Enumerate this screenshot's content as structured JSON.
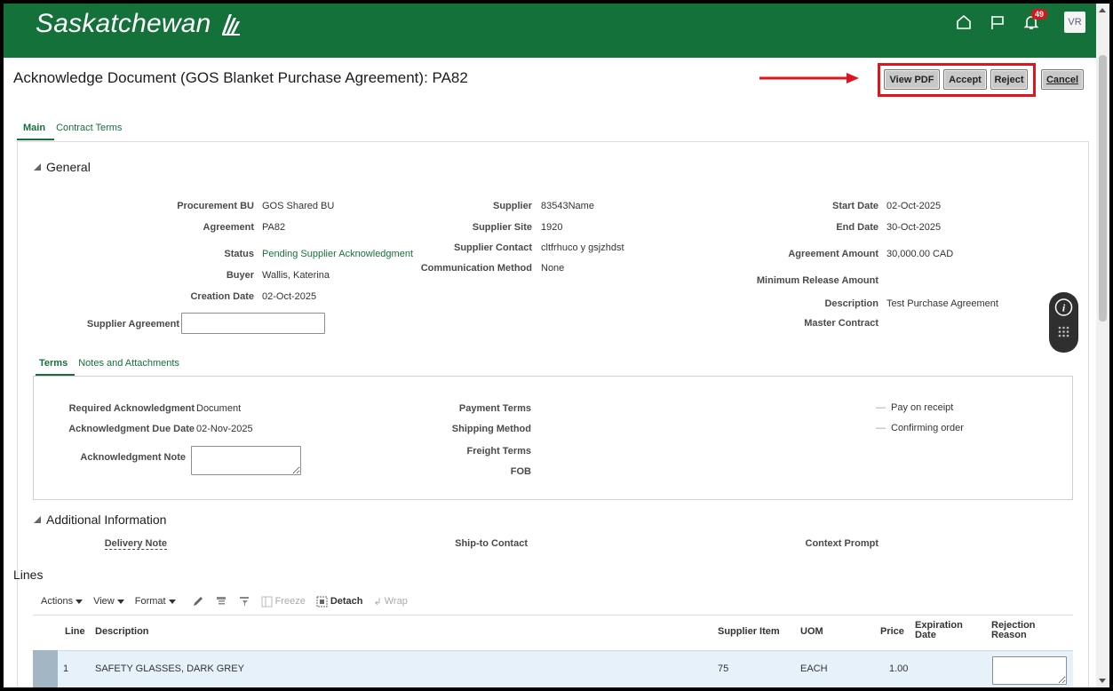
{
  "header": {
    "logo_text": "Saskatchewan",
    "icons": [
      "home-icon",
      "flag-icon",
      "bell-icon"
    ],
    "notification_count": "49",
    "avatar_initials": "VR",
    "brand_color": "#15713a"
  },
  "page": {
    "title": "Acknowledge Document (GOS Blanket Purchase Agreement): PA82"
  },
  "actions": {
    "view_pdf": "View PDF",
    "accept": "Accept",
    "reject": "Reject",
    "cancel": "Cancel",
    "highlight_color": "#e0141c"
  },
  "tabs": {
    "main": "Main",
    "contract_terms": "Contract Terms"
  },
  "general": {
    "title": "General",
    "procurement_bu_label": "Procurement BU",
    "procurement_bu": "GOS Shared BU",
    "agreement_label": "Agreement",
    "agreement": "PA82",
    "status_label": "Status",
    "status": "Pending Supplier Acknowledgment",
    "buyer_label": "Buyer",
    "buyer": "Wallis, Katerina",
    "creation_date_label": "Creation Date",
    "creation_date": "02-Oct-2025",
    "supplier_agreement_label": "Supplier Agreement",
    "supplier_agreement": "",
    "supplier_label": "Supplier",
    "supplier": "83543Name",
    "supplier_site_label": "Supplier Site",
    "supplier_site": "1920",
    "supplier_contact_label": "Supplier Contact",
    "supplier_contact": "cltfrhuco y gsjzhdst",
    "communication_method_label": "Communication Method",
    "communication_method": "None",
    "start_date_label": "Start Date",
    "start_date": "02-Oct-2025",
    "end_date_label": "End Date",
    "end_date": "30-Oct-2025",
    "agreement_amount_label": "Agreement Amount",
    "agreement_amount": "30,000.00 CAD",
    "min_release_label": "Minimum Release Amount",
    "description_label": "Description",
    "description": "Test Purchase Agreement",
    "master_contract_label": "Master Contract"
  },
  "subtabs": {
    "terms": "Terms",
    "notes": "Notes and Attachments"
  },
  "terms": {
    "required_ack_label": "Required Acknowledgment",
    "required_ack": "Document",
    "ack_due_label": "Acknowledgment Due Date",
    "ack_due": "02-Nov-2025",
    "ack_note_label": "Acknowledgment Note",
    "payment_terms_label": "Payment Terms",
    "shipping_method_label": "Shipping Method",
    "freight_terms_label": "Freight Terms",
    "fob_label": "FOB",
    "pay_on_receipt": "Pay on receipt",
    "confirming_order": "Confirming order"
  },
  "additional": {
    "title": "Additional Information",
    "delivery_note_label": "Delivery Note",
    "ship_to_contact_label": "Ship-to Contact",
    "context_prompt_label": "Context Prompt"
  },
  "lines": {
    "title": "Lines",
    "toolbar": {
      "actions": "Actions",
      "view": "View",
      "format": "Format",
      "freeze": "Freeze",
      "detach": "Detach",
      "wrap": "Wrap"
    },
    "columns": {
      "line": "Line",
      "description": "Description",
      "supplier_item": "Supplier Item",
      "uom": "UOM",
      "price": "Price",
      "expiration_date": "Expiration Date",
      "rejection_reason": "Rejection Reason"
    },
    "rows": [
      {
        "line": "1",
        "description": "SAFETY GLASSES, DARK GREY",
        "supplier_item": "75",
        "uom": "EACH",
        "price": "1.00"
      }
    ]
  }
}
